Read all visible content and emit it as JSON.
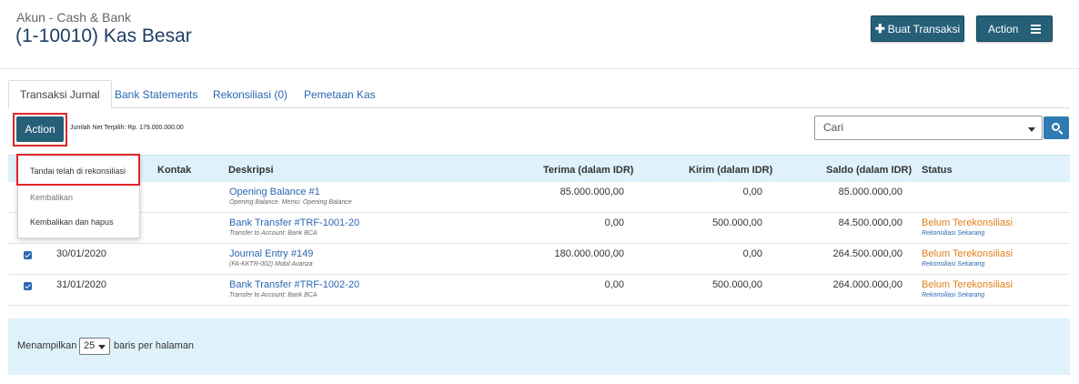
{
  "header": {
    "subtitle": "Akun - Cash & Bank",
    "title": "(1-10010) Kas Besar",
    "create_button": "Buat Transaksi",
    "action_button": "Action"
  },
  "tabs": [
    {
      "label": "Transaksi Jurnal",
      "active": true
    },
    {
      "label": "Bank Statements",
      "active": false
    },
    {
      "label": "Rekonsiliasi (0)",
      "active": false
    },
    {
      "label": "Pemetaan Kas",
      "active": false
    }
  ],
  "toolbar": {
    "action_label": "Action",
    "net_selected": "Jumlah Net Terpilih: Rp. 179.000.000,00",
    "search_placeholder": "Cari"
  },
  "dropdown": {
    "items": [
      "Tandai telah di rekonsiliasi",
      "Kembalikan",
      "Kembalikan dan hapus"
    ]
  },
  "table": {
    "headers": {
      "kontak": "Kontak",
      "deskripsi": "Deskripsi",
      "terima": "Terima (dalam IDR)",
      "kirim": "Kirim (dalam IDR)",
      "saldo": "Saldo (dalam IDR)",
      "status": "Status"
    },
    "rows": [
      {
        "checked": false,
        "date": "",
        "desc": "Opening Balance #1",
        "sub": "Opening Balance. Memo: Opening Balance",
        "terima": "85.000.000,00",
        "kirim": "0,00",
        "saldo": "85.000.000,00",
        "status": "",
        "status_link": ""
      },
      {
        "checked": false,
        "date": "",
        "desc": "Bank Transfer #TRF-1001-20",
        "sub": "Transfer to Account: Bank BCA",
        "terima": "0,00",
        "kirim": "500.000,00",
        "saldo": "84.500.000,00",
        "status": "Belum Terekonsiliasi",
        "status_link": "Rekonsiliasi Sekarang"
      },
      {
        "checked": true,
        "date": "30/01/2020",
        "desc": "Journal Entry #149",
        "sub": "(FA-KKTR-002) Mobil Avanza",
        "terima": "180.000.000,00",
        "kirim": "0,00",
        "saldo": "264.500.000,00",
        "status": "Belum Terekonsiliasi",
        "status_link": "Rekonsiliasi Sekarang"
      },
      {
        "checked": true,
        "date": "31/01/2020",
        "desc": "Bank Transfer #TRF-1002-20",
        "sub": "Transfer to Account: Bank BCA",
        "terima": "0,00",
        "kirim": "500.000,00",
        "saldo": "264.000.000,00",
        "status": "Belum Terekonsiliasi",
        "status_link": "Rekonsiliasi Sekarang"
      }
    ]
  },
  "footer": {
    "label": "Menampilkan",
    "per_page": "25",
    "suffix": "baris per halaman"
  },
  "colors": {
    "primary": "#255f78",
    "link": "#2a67b1",
    "status": "#e07e1a",
    "highlight": "#e0262b",
    "table_header_bg": "#dff2fb"
  }
}
